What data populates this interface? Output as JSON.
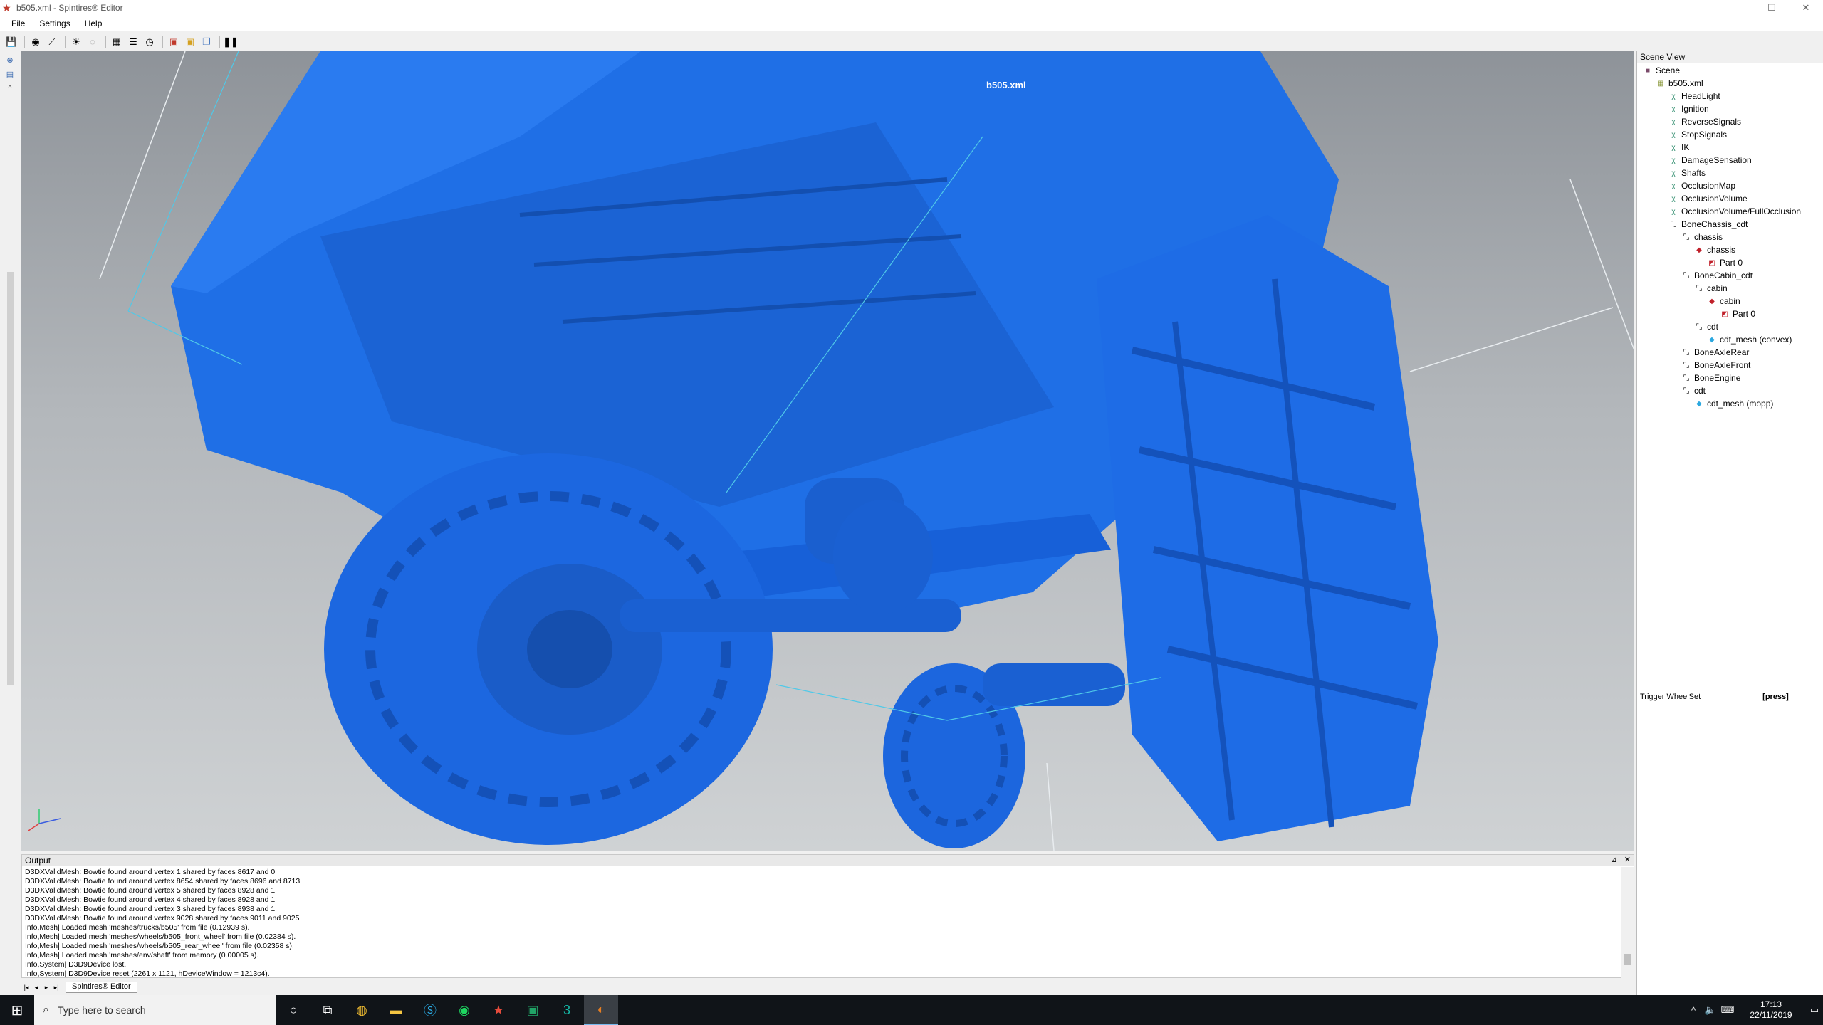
{
  "window": {
    "title": "b505.xml - Spintires® Editor",
    "controls": {
      "minimize": "—",
      "maximize": "☐",
      "close": "✕"
    }
  },
  "menu": {
    "file": "File",
    "settings": "Settings",
    "help": "Help"
  },
  "toolbar": {
    "icons": [
      "save-icon",
      "camera-icon",
      "select-icon",
      "light-icon",
      "texture-icon",
      "grid-icon",
      "list-icon",
      "clock-icon",
      "mesh-icon",
      "material-icon",
      "copy-icon",
      "pause-icon"
    ]
  },
  "viewport": {
    "selected_label": "b505.xml",
    "model_color": "#1f6fe6"
  },
  "output": {
    "title": "Output",
    "lines": [
      "D3DXValidMesh: Bowtie found around vertex 1 shared by faces 8617 and 0",
      "D3DXValidMesh: Bowtie found around vertex 8654 shared by faces 8696 and 8713",
      "D3DXValidMesh: Bowtie found around vertex 5 shared by faces 8928 and 1",
      "D3DXValidMesh: Bowtie found around vertex 4 shared by faces 8928 and 1",
      "D3DXValidMesh: Bowtie found around vertex 3 shared by faces 8938 and 1",
      "D3DXValidMesh: Bowtie found around vertex 9028 shared by faces 9011 and 9025",
      "Info,Mesh| Loaded mesh 'meshes/trucks/b505' from file (0.12939 s).",
      "Info,Mesh| Loaded mesh 'meshes/wheels/b505_front_wheel' from file (0.02384 s).",
      "Info,Mesh| Loaded mesh 'meshes/wheels/b505_rear_wheel' from file (0.02358 s).",
      "Info,Mesh| Loaded mesh 'meshes/env/shaft' from memory (0.00005 s).",
      "Info,System| D3D9Device lost.",
      "Info,System| D3D9Device reset (2261 x 1121, hDeviceWindow = 1213c4)."
    ]
  },
  "tabs": {
    "active": "Spintires® Editor"
  },
  "scene_view": {
    "title": "Scene View",
    "tree": [
      {
        "label": "Scene",
        "depth": 0,
        "icon": "scene-icon"
      },
      {
        "label": "b505.xml",
        "depth": 1,
        "icon": "xml-file-icon"
      },
      {
        "label": "HeadLight",
        "depth": 2,
        "icon": "constraint-icon"
      },
      {
        "label": "Ignition",
        "depth": 2,
        "icon": "constraint-icon"
      },
      {
        "label": "ReverseSignals",
        "depth": 2,
        "icon": "constraint-icon"
      },
      {
        "label": "StopSignals",
        "depth": 2,
        "icon": "constraint-icon"
      },
      {
        "label": "IK",
        "depth": 2,
        "icon": "constraint-icon"
      },
      {
        "label": "DamageSensation",
        "depth": 2,
        "icon": "constraint-icon"
      },
      {
        "label": "Shafts",
        "depth": 2,
        "icon": "constraint-icon"
      },
      {
        "label": "OcclusionMap",
        "depth": 2,
        "icon": "constraint-icon"
      },
      {
        "label": "OcclusionVolume",
        "depth": 2,
        "icon": "constraint-icon"
      },
      {
        "label": "OcclusionVolume/FullOcclusion",
        "depth": 2,
        "icon": "constraint-icon"
      },
      {
        "label": "BoneChassis_cdt",
        "depth": 2,
        "icon": "bone-icon"
      },
      {
        "label": "chassis",
        "depth": 3,
        "icon": "bone-icon"
      },
      {
        "label": "chassis",
        "depth": 4,
        "icon": "mesh-icon"
      },
      {
        "label": "Part 0",
        "depth": 5,
        "icon": "part-icon"
      },
      {
        "label": "BoneCabin_cdt",
        "depth": 3,
        "icon": "bone-icon"
      },
      {
        "label": "cabin",
        "depth": 4,
        "icon": "bone-icon"
      },
      {
        "label": "cabin",
        "depth": 5,
        "icon": "mesh-icon"
      },
      {
        "label": "Part 0",
        "depth": 6,
        "icon": "part-icon"
      },
      {
        "label": "cdt",
        "depth": 4,
        "icon": "bone-icon"
      },
      {
        "label": "cdt_mesh (convex)",
        "depth": 5,
        "icon": "collision-icon"
      },
      {
        "label": "BoneAxleRear",
        "depth": 3,
        "icon": "bone-icon"
      },
      {
        "label": "BoneAxleFront",
        "depth": 3,
        "icon": "bone-icon"
      },
      {
        "label": "BoneEngine",
        "depth": 3,
        "icon": "bone-icon"
      },
      {
        "label": "cdt",
        "depth": 3,
        "icon": "bone-icon"
      },
      {
        "label": "cdt_mesh (mopp)",
        "depth": 4,
        "icon": "collision-icon"
      }
    ],
    "trigger": {
      "name": "Trigger WheelSet",
      "value": "[press]"
    }
  },
  "taskbar": {
    "search_placeholder": "Type here to search",
    "time": "17:13",
    "date": "22/11/2019",
    "apps": [
      "cortana-icon",
      "task-view-icon",
      "chrome-icon",
      "file-explorer-icon",
      "skype-icon",
      "spotify-icon",
      "spintires-icon",
      "excel-icon",
      "3dsmax-icon",
      "editor-icon"
    ]
  }
}
